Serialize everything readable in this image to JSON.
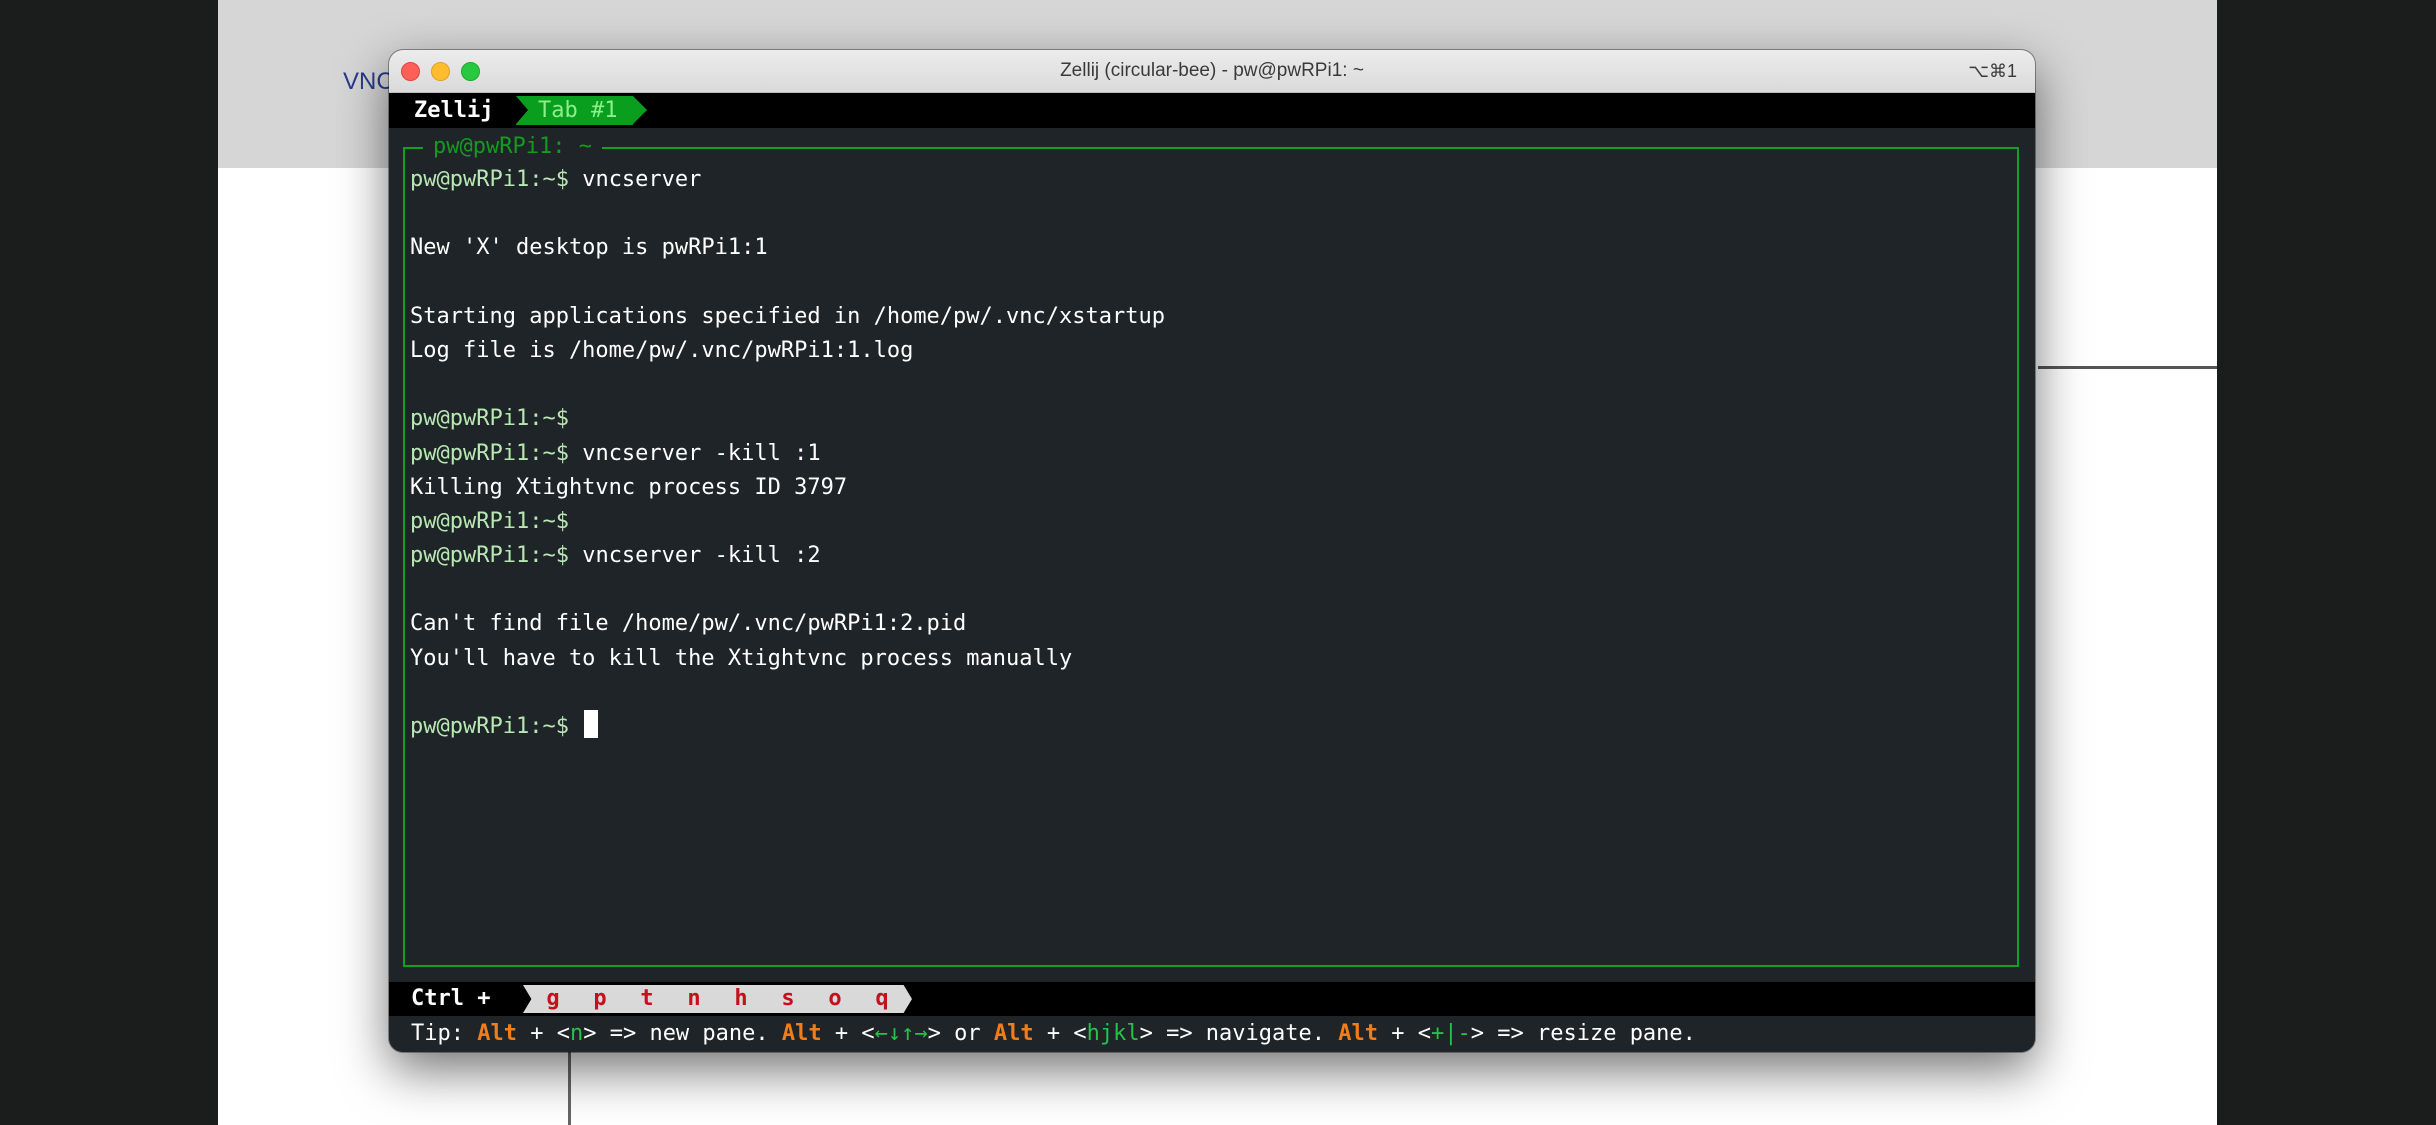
{
  "background": {
    "label": "VNC"
  },
  "window": {
    "title": "Zellij (circular-bee) - pw@pwRPi1: ~",
    "shortcut": "⌥⌘1"
  },
  "tabbar": {
    "app_name": "Zellij",
    "active_tab": "Tab #1"
  },
  "pane": {
    "title": "pw@pwRPi1: ~"
  },
  "terminal": {
    "prompt": "pw@pwRPi1:~$",
    "lines": [
      {
        "prompt": "pw@pwRPi1:~$",
        "text": " vncserver"
      },
      {
        "prompt": "",
        "text": ""
      },
      {
        "prompt": "",
        "text": "New 'X' desktop is pwRPi1:1"
      },
      {
        "prompt": "",
        "text": ""
      },
      {
        "prompt": "",
        "text": "Starting applications specified in /home/pw/.vnc/xstartup"
      },
      {
        "prompt": "",
        "text": "Log file is /home/pw/.vnc/pwRPi1:1.log"
      },
      {
        "prompt": "",
        "text": ""
      },
      {
        "prompt": "pw@pwRPi1:~$",
        "text": ""
      },
      {
        "prompt": "pw@pwRPi1:~$",
        "text": " vncserver -kill :1"
      },
      {
        "prompt": "",
        "text": "Killing Xtightvnc process ID 3797"
      },
      {
        "prompt": "pw@pwRPi1:~$",
        "text": ""
      },
      {
        "prompt": "pw@pwRPi1:~$",
        "text": " vncserver -kill :2"
      },
      {
        "prompt": "",
        "text": ""
      },
      {
        "prompt": "",
        "text": "Can't find file /home/pw/.vnc/pwRPi1:2.pid"
      },
      {
        "prompt": "",
        "text": "You'll have to kill the Xtightvnc process manually"
      },
      {
        "prompt": "",
        "text": ""
      },
      {
        "prompt": "pw@pwRPi1:~$",
        "text": " ",
        "cursor": true
      }
    ]
  },
  "keybar": {
    "modifier": "Ctrl +",
    "keys": [
      "g",
      "p",
      "t",
      "n",
      "h",
      "s",
      "o",
      "q"
    ]
  },
  "tip": {
    "prefix": "Tip: ",
    "alt1": "Alt",
    "seg1": " + <",
    "key1": "n",
    "seg2": "> => new pane. ",
    "alt2": "Alt",
    "seg3": " + <",
    "key2": "←↓↑→",
    "seg4": "> or ",
    "alt3": "Alt",
    "seg5": " + <",
    "key3": "hjkl",
    "seg6": "> => navigate. ",
    "alt4": "Alt",
    "seg7": " + <",
    "key4": "+|-",
    "seg8": "> => resize pane."
  },
  "colors": {
    "accent_green": "#0a9e1e",
    "prompt_green": "#b8e8b2",
    "alt_orange": "#f07d1a",
    "key_red": "#c3121b"
  }
}
